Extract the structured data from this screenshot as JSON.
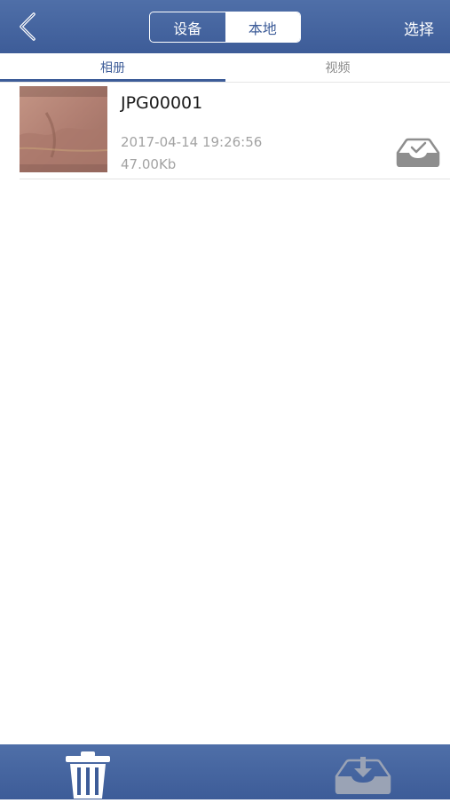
{
  "header": {
    "back_icon": "chevron-left-icon",
    "segments": [
      "设备",
      "本地"
    ],
    "selected_segment": "本地",
    "select_label": "选择"
  },
  "tabs": [
    {
      "label": "相册",
      "active": true
    },
    {
      "label": "视频",
      "active": false
    }
  ],
  "files": [
    {
      "name": "JPG00001",
      "date": "2017-04-14 19:26:56",
      "size": "47.00Kb",
      "status_icon": "inbox-check-icon"
    }
  ],
  "toolbar": {
    "delete_icon": "trash-icon",
    "download_icon": "download-tray-icon"
  },
  "colors": {
    "primary": "#3d5c98",
    "header_gradient_top": "#4f6fa8",
    "muted_text": "#a3a3a3",
    "inactive_tab": "#8a8a8a"
  }
}
